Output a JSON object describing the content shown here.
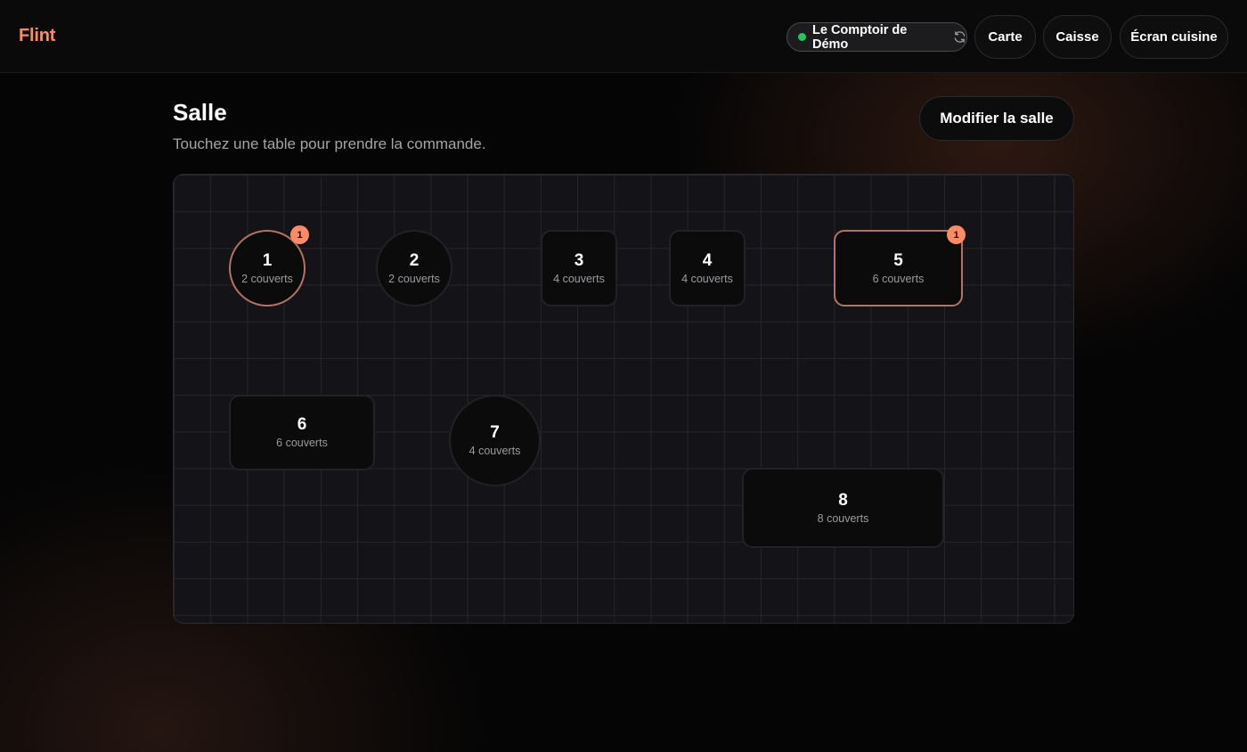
{
  "colors": {
    "accent": "#ff8a65",
    "status_online": "#22c55e",
    "active_table_border": "#b47262"
  },
  "header": {
    "brand": "Flint",
    "venue": {
      "name": "Le Comptoir de Démo",
      "status": "online",
      "refresh_icon": "refresh-icon"
    },
    "nav": [
      {
        "label": "Carte"
      },
      {
        "label": "Caisse"
      },
      {
        "label": "Écran cuisine"
      }
    ]
  },
  "main": {
    "title": "Salle",
    "subtitle": "Touchez une table pour prendre la commande.",
    "edit_button": "Modifier la salle"
  },
  "tables": [
    {
      "number": "1",
      "seats": "2 couverts",
      "shape": "round",
      "active": true,
      "badge": "1"
    },
    {
      "number": "2",
      "seats": "2 couverts",
      "shape": "round",
      "active": false,
      "badge": null
    },
    {
      "number": "3",
      "seats": "4 couverts",
      "shape": "rect",
      "active": false,
      "badge": null
    },
    {
      "number": "4",
      "seats": "4 couverts",
      "shape": "rect",
      "active": false,
      "badge": null
    },
    {
      "number": "5",
      "seats": "6 couverts",
      "shape": "rect",
      "active": true,
      "badge": "1"
    },
    {
      "number": "6",
      "seats": "6 couverts",
      "shape": "rect",
      "active": false,
      "badge": null
    },
    {
      "number": "7",
      "seats": "4 couverts",
      "shape": "round",
      "active": false,
      "badge": null
    },
    {
      "number": "8",
      "seats": "8 couverts",
      "shape": "rect",
      "active": false,
      "badge": null
    }
  ]
}
